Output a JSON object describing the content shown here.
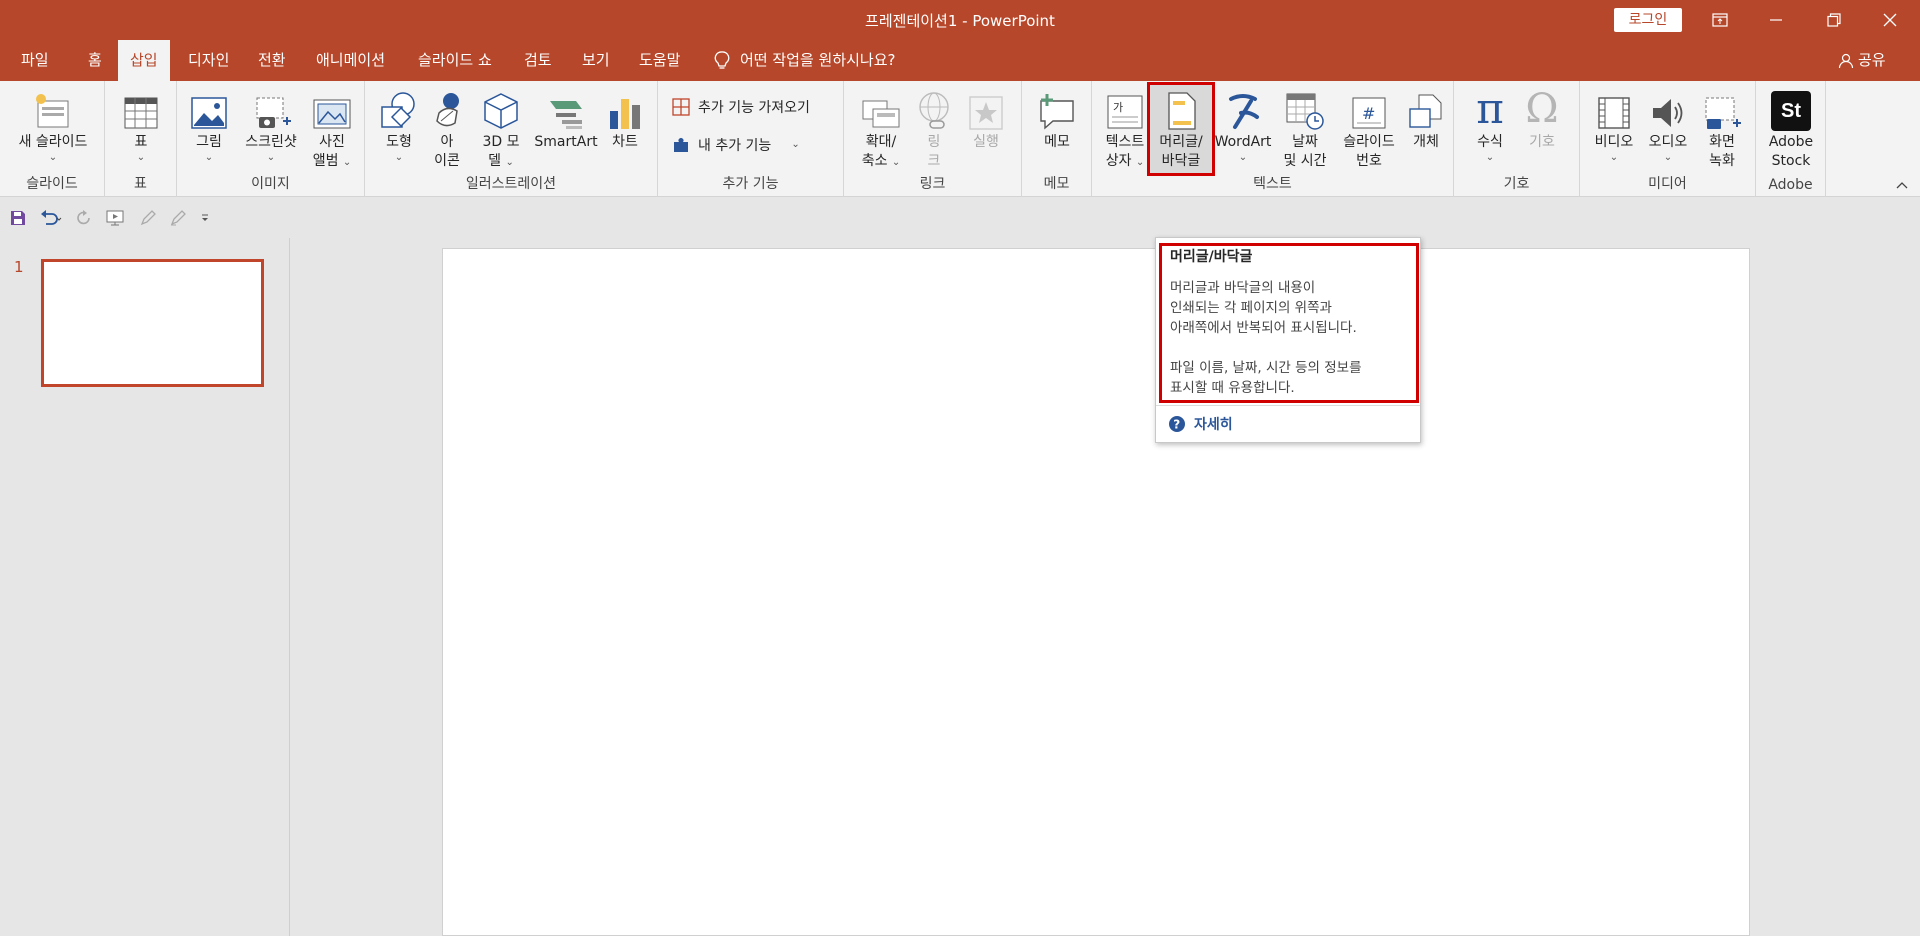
{
  "app": {
    "title": "프레젠테이션1  -  PowerPoint",
    "login_label": "로그인",
    "accent_color": "#b7472a"
  },
  "tabs": [
    {
      "label": "파일"
    },
    {
      "label": "홈"
    },
    {
      "label": "삽입",
      "active": true
    },
    {
      "label": "디자인"
    },
    {
      "label": "전환"
    },
    {
      "label": "애니메이션"
    },
    {
      "label": "슬라이드 쇼"
    },
    {
      "label": "검토"
    },
    {
      "label": "보기"
    },
    {
      "label": "도움말"
    }
  ],
  "tell_me": "어떤 작업을 원하시나요?",
  "share_label": "공유",
  "ribbon": {
    "groups": {
      "slides": "슬라이드",
      "tables": "표",
      "images": "이미지",
      "illustrations": "일러스트레이션",
      "addins": "추가 기능",
      "links": "링크",
      "comments": "메모",
      "text": "텍스트",
      "symbols": "기호",
      "media": "미디어",
      "adobe": "Adobe"
    },
    "buttons": {
      "new_slide": "새 슬라이드",
      "table": "표",
      "picture": "그림",
      "screenshot": "스크린샷",
      "album_1": "사진",
      "album_2": "앨범",
      "shapes": "도형",
      "icons_1": "아",
      "icons_2": "이콘",
      "model_1": "3D 모",
      "model_2": "델",
      "smartart": "SmartArt",
      "chart": "차트",
      "get_addins": "추가 기능 가져오기",
      "my_addins": "내 추가 기능",
      "zoom_1": "확대/",
      "zoom_2": "축소",
      "link_1": "링",
      "link_2": "크",
      "action": "실행",
      "comment": "메모",
      "textbox_1": "텍스트",
      "textbox_2": "상자",
      "header_1": "머리글/",
      "header_2": "바닥글",
      "wordart": "WordArt",
      "datetime_1": "날짜",
      "datetime_2": "및 시간",
      "slidenum_1": "슬라이드",
      "slidenum_2": "번호",
      "object": "개체",
      "equation": "수식",
      "symbol": "기호",
      "video": "비디오",
      "audio": "오디오",
      "screenrec_1": "화면",
      "screenrec_2": "녹화",
      "adobe_1": "Adobe",
      "adobe_2": "Stock",
      "adobe_logo": "St",
      "textbox_glyph": "가",
      "slidenum_glyph": "#",
      "equation_glyph": "π",
      "symbol_glyph": "Ω"
    }
  },
  "thumbnails": [
    {
      "number": "1"
    }
  ],
  "tooltip": {
    "title": "머리글/바닥글",
    "body": "머리글과 바닥글의 내용이\n인쇄되는 각 페이지의 위쪽과\n아래쪽에서 반복되어 표시됩니다.\n\n파일 이름, 날짜, 시간 등의 정보를\n표시할 때 유용합니다.",
    "more": "자세히"
  }
}
